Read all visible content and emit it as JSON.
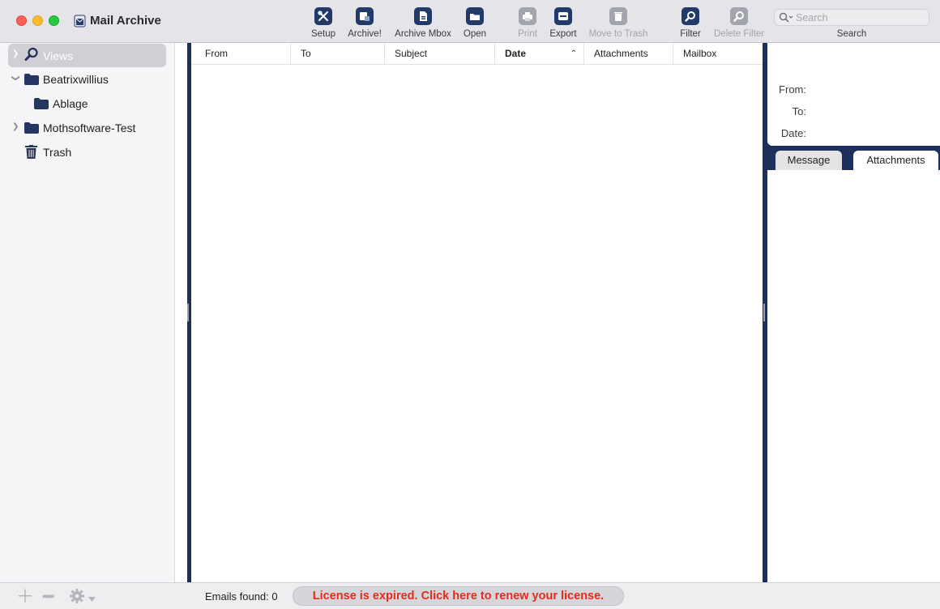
{
  "app": {
    "title": "Mail Archive"
  },
  "toolbar": {
    "buttons": [
      {
        "label": "Setup",
        "icon": "setup-tools-icon",
        "enabled": true
      },
      {
        "label": "Archive!",
        "icon": "archive-icon",
        "enabled": true
      },
      {
        "label": "Archive Mbox",
        "icon": "archive-mbox-icon",
        "enabled": true
      },
      {
        "label": "Open",
        "icon": "open-folder-icon",
        "enabled": true
      },
      {
        "label": "Print",
        "icon": "printer-icon",
        "enabled": false
      },
      {
        "label": "Export",
        "icon": "export-icon",
        "enabled": true
      },
      {
        "label": "Move to Trash",
        "icon": "trash-icon",
        "enabled": false
      },
      {
        "label": "Filter",
        "icon": "filter-magnifier-icon",
        "enabled": true
      },
      {
        "label": "Delete Filter",
        "icon": "delete-filter-icon",
        "enabled": false
      }
    ],
    "search": {
      "placeholder": "Search",
      "value": "",
      "label": "Search"
    }
  },
  "sidebar": {
    "items": [
      {
        "label": "Views",
        "icon": "magnifier-icon",
        "selected": true,
        "expandable": true,
        "expanded": false
      },
      {
        "label": "Beatrixwillius",
        "icon": "folder-icon",
        "expandable": true,
        "expanded": true
      },
      {
        "label": "Ablage",
        "icon": "folder-icon",
        "expandable": false
      },
      {
        "label": "Mothsoftware-Test",
        "icon": "folder-icon",
        "expandable": true,
        "expanded": false
      },
      {
        "label": "Trash",
        "icon": "trash-icon",
        "expandable": false
      }
    ]
  },
  "message_list": {
    "columns": [
      "From",
      "To",
      "Subject",
      "Date",
      "Attachments",
      "Mailbox"
    ],
    "sorted_column": "Date",
    "rows": []
  },
  "preview": {
    "header_labels": {
      "from": "From:",
      "to": "To:",
      "date": "Date:"
    },
    "tabs": [
      {
        "label": "Message",
        "active": false
      },
      {
        "label": "Attachments",
        "active": true
      }
    ]
  },
  "statusbar": {
    "emails_found": "Emails found: 0",
    "license_message": "License is expired. Click here to renew your license."
  },
  "colors": {
    "accent": "#213a6a",
    "license_text": "#e8291c",
    "pane_border": "#1f2f5b"
  }
}
